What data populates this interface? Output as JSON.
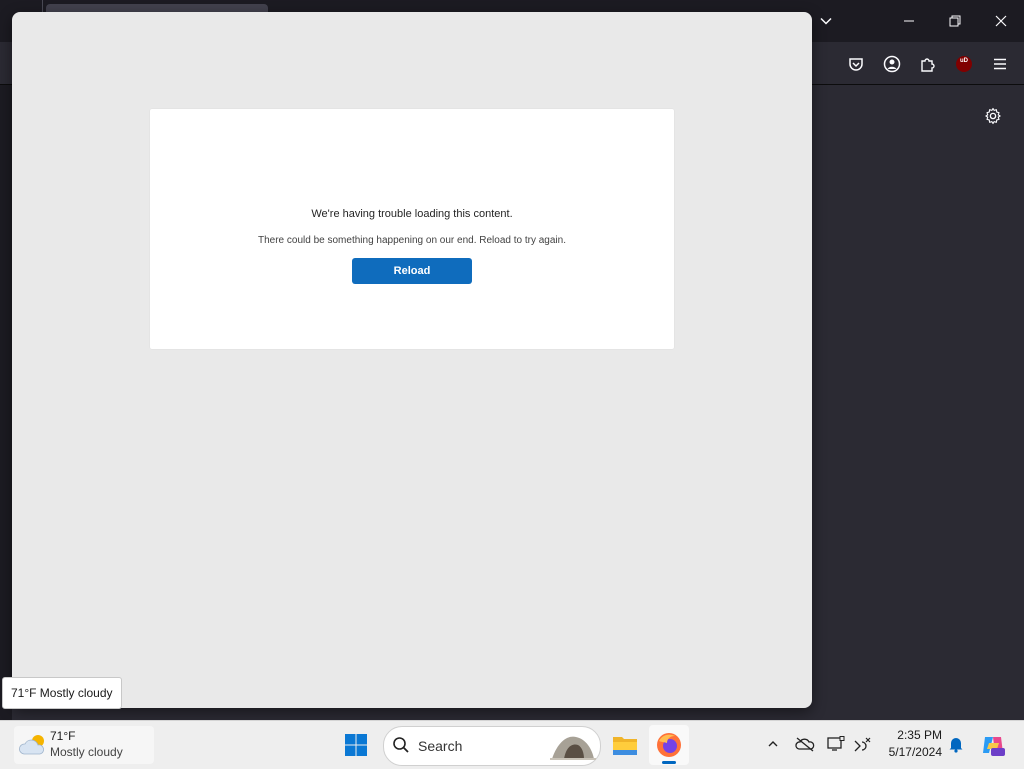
{
  "dialog": {
    "title": "We're having trouble loading this content.",
    "message": "There could be something happening on our end. Reload to try again.",
    "reload_label": "Reload"
  },
  "tooltip": {
    "text": "71°F Mostly cloudy"
  },
  "taskbar": {
    "weather": {
      "temp": "71°F",
      "desc": "Mostly cloudy",
      "icon": "partly-cloudy-icon"
    },
    "search": {
      "placeholder": "Search"
    },
    "apps": [
      "start-button",
      "file-explorer-icon",
      "firefox-icon"
    ],
    "clock": {
      "time": "2:35 PM",
      "date": "5/17/2024"
    }
  },
  "browser": {
    "extension_badge": "uD"
  },
  "colors": {
    "accent": "#0f6cbd",
    "modal_bg": "#e9e9e9",
    "browser_dark": "#1c1b22",
    "taskbar": "#eeeeee"
  }
}
